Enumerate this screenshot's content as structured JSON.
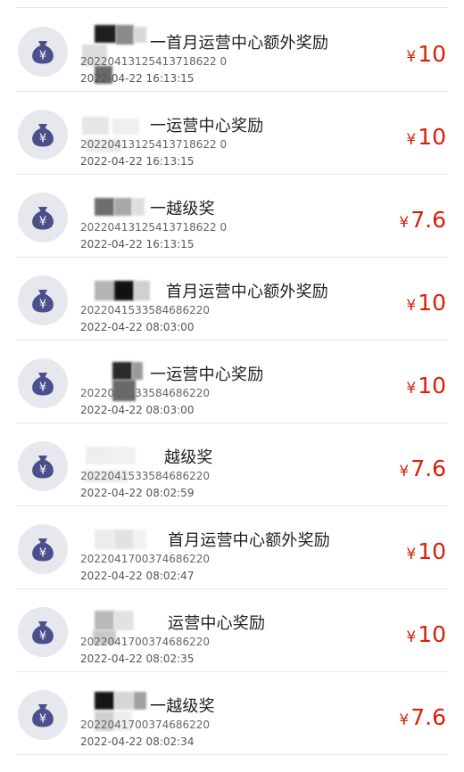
{
  "theme": {
    "amount_color": "#d81e06",
    "avatar_bg": "#e7e7ee",
    "icon_color": "#4b4f8c"
  },
  "records": [
    {
      "title": "一首月运营中心额外奖励",
      "order_id": "20220413125413718622 0",
      "time": "2022-04-22 16:13:15",
      "currency": "¥",
      "amount": "10",
      "icon": "money-bag-icon"
    },
    {
      "title": "一运营中心奖励",
      "order_id": "20220413125413718622 0",
      "time": "2022-04-22 16:13:15",
      "currency": "¥",
      "amount": "10",
      "icon": "money-bag-icon"
    },
    {
      "title": "一越级奖",
      "order_id": "20220413125413718622 0",
      "time": "2022-04-22 16:13:15",
      "currency": "¥",
      "amount": "7.6",
      "icon": "money-bag-icon"
    },
    {
      "title": "首月运营中心额外奖励",
      "order_id": "2022041533584686220",
      "time": "2022-04-22 08:03:00",
      "currency": "¥",
      "amount": "10",
      "icon": "money-bag-icon"
    },
    {
      "title": "一运营中心奖励",
      "order_id": "2022041533584686220",
      "time": "2022-04-22 08:03:00",
      "currency": "¥",
      "amount": "10",
      "icon": "money-bag-icon"
    },
    {
      "title": "越级奖",
      "order_id": "2022041533584686220",
      "time": "2022-04-22 08:02:59",
      "currency": "¥",
      "amount": "7.6",
      "icon": "money-bag-icon"
    },
    {
      "title": "首月运营中心额外奖励",
      "order_id": "2022041700374686220",
      "time": "2022-04-22 08:02:47",
      "currency": "¥",
      "amount": "10",
      "icon": "money-bag-icon"
    },
    {
      "title": "运营中心奖励",
      "order_id": "2022041700374686220",
      "time": "2022-04-22 08:02:35",
      "currency": "¥",
      "amount": "10",
      "icon": "money-bag-icon"
    },
    {
      "title": "一越级奖",
      "order_id": "2022041700374686220",
      "time": "2022-04-22 08:02:34",
      "currency": "¥",
      "amount": "7.6",
      "icon": "money-bag-icon"
    }
  ]
}
